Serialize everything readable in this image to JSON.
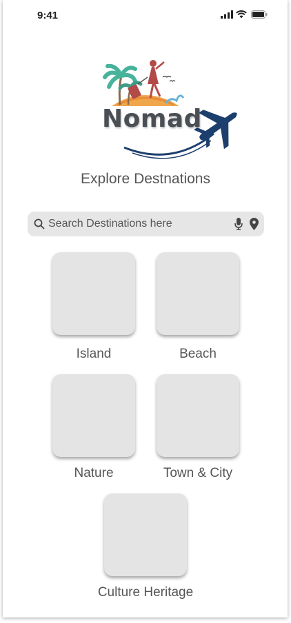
{
  "status_bar": {
    "time": "9:41"
  },
  "logo": {
    "wordmark": "Nomad"
  },
  "subtitle": "Explore Destnations",
  "search": {
    "placeholder": "Search Destinations here",
    "value": ""
  },
  "categories": [
    {
      "label": "Island"
    },
    {
      "label": "Beach"
    },
    {
      "label": "Nature"
    },
    {
      "label": "Town & City"
    },
    {
      "label": "Culture Heritage"
    }
  ],
  "colors": {
    "tile": "#e4e4e4",
    "search_bg": "#e6e6e6",
    "text": "#555555",
    "brand_navy": "#1d3f6e",
    "brand_orange": "#f0a64a",
    "brand_red": "#b24a48",
    "brand_teal": "#47b39a"
  }
}
